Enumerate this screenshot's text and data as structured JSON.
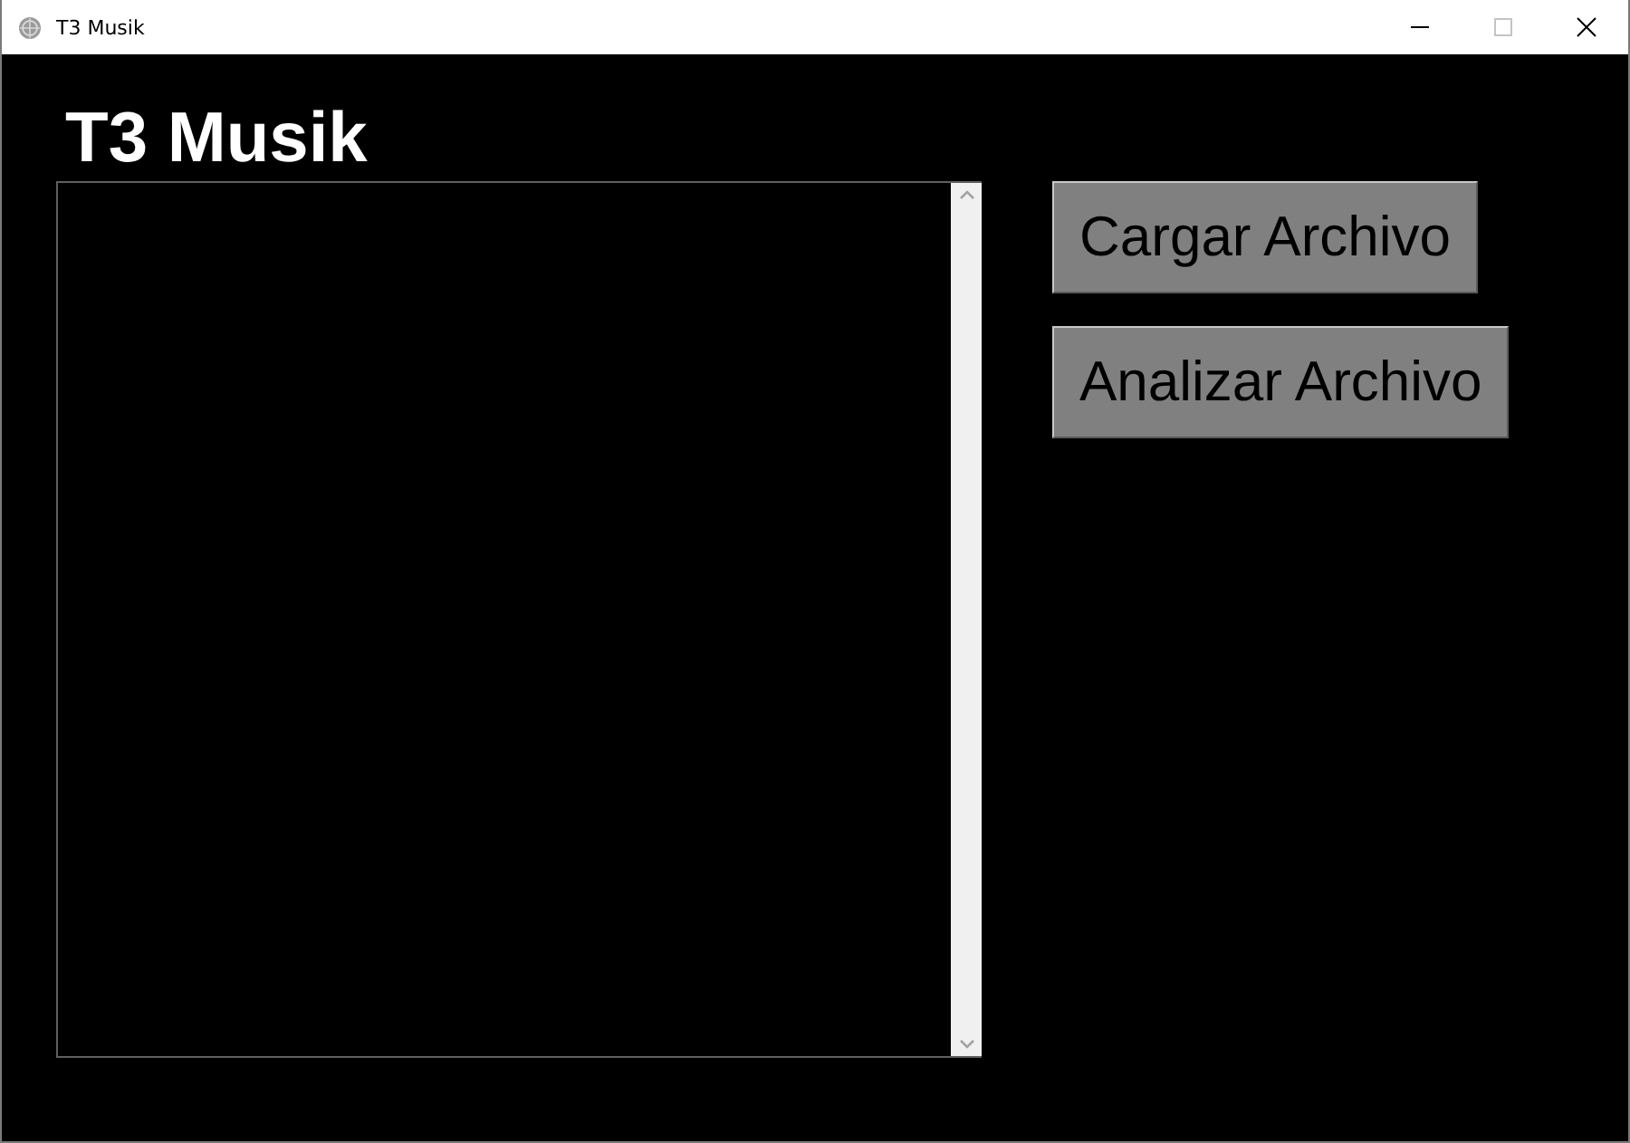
{
  "window": {
    "title": "T3 Musik",
    "controls": [
      {
        "kind": "minimize",
        "disabled": false
      },
      {
        "kind": "maximize",
        "disabled": true
      },
      {
        "kind": "close",
        "disabled": false
      }
    ]
  },
  "heading": "T3 Musik",
  "buttons": [
    "Cargar Archivo",
    "Analizar Archivo"
  ]
}
